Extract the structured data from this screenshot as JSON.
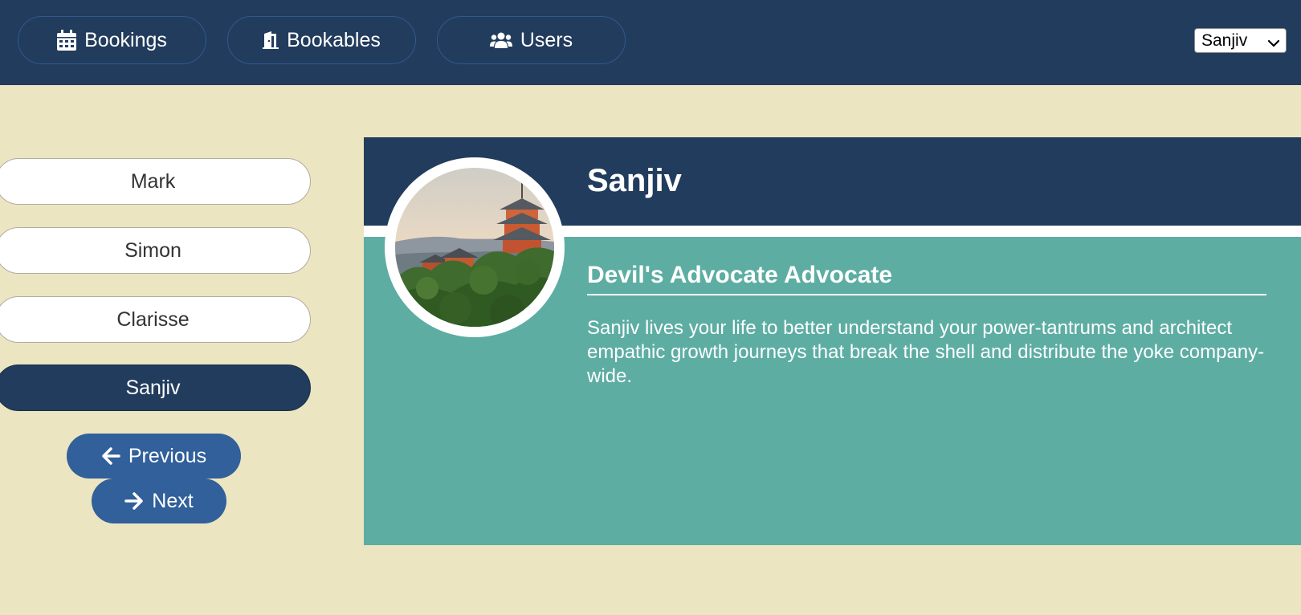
{
  "nav": {
    "items": [
      {
        "label": "Bookings",
        "icon": "calendar-icon"
      },
      {
        "label": "Bookables",
        "icon": "door-icon"
      },
      {
        "label": "Users",
        "icon": "users-icon"
      }
    ],
    "user_picker": {
      "selected": "Sanjiv"
    }
  },
  "users": {
    "list": [
      {
        "label": "Mark"
      },
      {
        "label": "Simon"
      },
      {
        "label": "Clarisse"
      },
      {
        "label": "Sanjiv"
      }
    ],
    "selected": "Sanjiv",
    "previous_label": "Previous",
    "next_label": "Next",
    "previous_icon": "arrow-left-icon",
    "next_icon": "arrow-right-icon"
  },
  "details": {
    "name": "Sanjiv",
    "title": "Devil's Advocate Advocate",
    "notes": "Sanjiv lives your life to better understand your power-tantrums and architect empathic growth journeys that break the shell and distribute the yoke company-wide.",
    "avatar": "pagoda-photo"
  },
  "colors": {
    "header_bg": "#223c5d",
    "page_bg": "#ece5c1",
    "accent_button": "#31609a",
    "details_bg": "#5dada3"
  }
}
